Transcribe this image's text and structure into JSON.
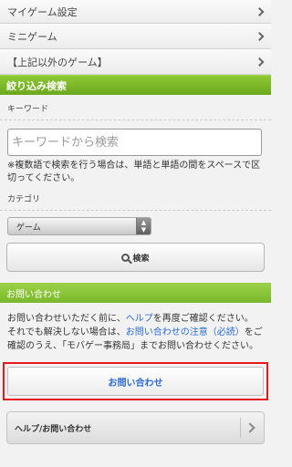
{
  "menu": {
    "items": [
      {
        "label": "マイゲーム設定"
      },
      {
        "label": "ミニゲーム"
      },
      {
        "label": "【上記以外のゲーム】"
      }
    ]
  },
  "filter": {
    "header": "絞り込み検索",
    "keyword_label": "キーワード",
    "keyword_placeholder": "キーワードから検索",
    "keyword_value": "",
    "note": "※複数語で検索を行う場合は、単語と単語の間をスペースで区切ってください。",
    "category_label": "カテゴリ",
    "category_selected": "ゲーム",
    "search_button": "検索"
  },
  "contact": {
    "header": "お問い合わせ",
    "text_1": "お問い合わせいただく前に、",
    "help_link": "ヘルプ",
    "text_2": "を再度ご確認ください。 それでも解決しない場合は、",
    "notice_link": "お問い合わせの注意（必読）",
    "text_3": "をご確認のうえ、「モバゲー事務局」までお問い合わせください。",
    "contact_button": "お問い合わせ",
    "help_button": "ヘルプ/お問い合わせ"
  }
}
